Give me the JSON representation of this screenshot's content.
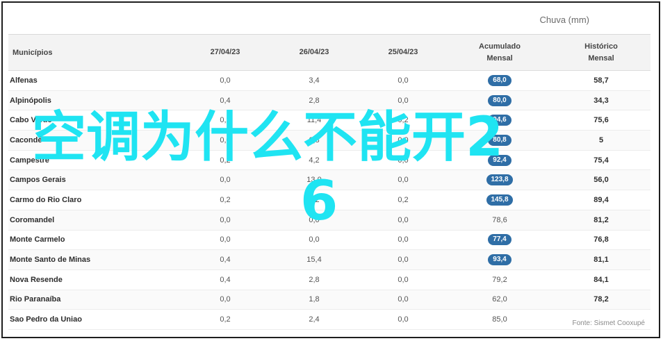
{
  "table": {
    "group_header": "Chuva (mm)",
    "columns": [
      "Municípios",
      "27/04/23",
      "26/04/23",
      "25/04/23",
      "Acumulado\nMensal",
      "Histórico\nMensal"
    ],
    "rows": [
      {
        "municipio": "Alfenas",
        "d27": "0,0",
        "d26": "3,4",
        "d25": "0,0",
        "acumulado": "68,0",
        "acum_highlight": true,
        "historico": "58,7"
      },
      {
        "municipio": "Alpinópolis",
        "d27": "0,4",
        "d26": "2,8",
        "d25": "0,0",
        "acumulado": "80,0",
        "acum_highlight": true,
        "historico": "34,3"
      },
      {
        "municipio": "Cabo Verde",
        "d27": "0,2",
        "d26": "11,4",
        "d25": "0,2",
        "acumulado": "94,6",
        "acum_highlight": true,
        "historico": "75,6"
      },
      {
        "municipio": "Cacondé",
        "d27": "0,0",
        "d26": "6,8",
        "d25": "0,0",
        "acumulado": "80,8",
        "acum_highlight": true,
        "historico": "5"
      },
      {
        "municipio": "Campestre",
        "d27": "0,2",
        "d26": "4,2",
        "d25": "0,0",
        "acumulado": "92,4",
        "acum_highlight": true,
        "historico": "75,4"
      },
      {
        "municipio": "Campos Gerais",
        "d27": "0,0",
        "d26": "13,0",
        "d25": "0,0",
        "acumulado": "123,8",
        "acum_highlight": true,
        "historico": "56,0"
      },
      {
        "municipio": "Carmo do Rio Claro",
        "d27": "0,2",
        "d26": "0,2",
        "d25": "0,2",
        "acumulado": "145,8",
        "acum_highlight": true,
        "historico": "89,4"
      },
      {
        "municipio": "Coromandel",
        "d27": "0,0",
        "d26": "0,0",
        "d25": "0,0",
        "acumulado": "78,6",
        "acum_highlight": false,
        "historico": "81,2"
      },
      {
        "municipio": "Monte Carmelo",
        "d27": "0,0",
        "d26": "0,0",
        "d25": "0,0",
        "acumulado": "77,4",
        "acum_highlight": true,
        "historico": "76,8"
      },
      {
        "municipio": "Monte Santo de Minas",
        "d27": "0,4",
        "d26": "15,4",
        "d25": "0,0",
        "acumulado": "93,4",
        "acum_highlight": true,
        "historico": "81,1"
      },
      {
        "municipio": "Nova Resende",
        "d27": "0,4",
        "d26": "2,8",
        "d25": "0,0",
        "acumulado": "79,2",
        "acum_highlight": false,
        "historico": "84,1"
      },
      {
        "municipio": "Rio Paranaíba",
        "d27": "0,0",
        "d26": "1,8",
        "d25": "0,0",
        "acumulado": "62,0",
        "acum_highlight": false,
        "historico": "78,2"
      },
      {
        "municipio": "Sao Pedro da Uniao",
        "d27": "0,2",
        "d26": "2,4",
        "d25": "0,0",
        "acumulado": "85,0",
        "acum_highlight": false,
        "historico": ""
      }
    ]
  },
  "source": "Fonte: Sismet Cooxupé",
  "overlay": {
    "line1": "空调为什么不能开2",
    "line2": "6"
  },
  "colors": {
    "pill": "#2f6ea6",
    "overlay_text": "#1fe4f2"
  }
}
